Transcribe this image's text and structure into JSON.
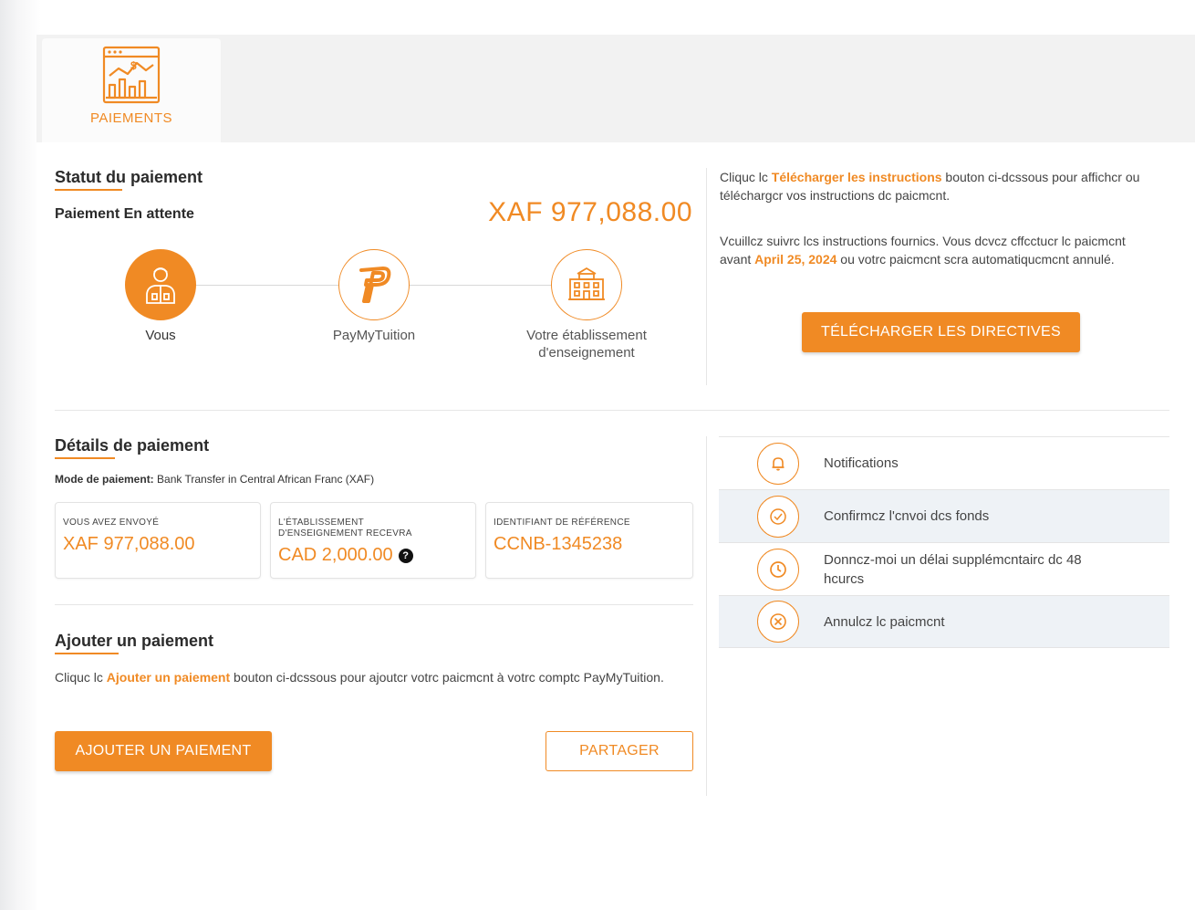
{
  "tab": {
    "label": "PAIEMENTS",
    "icon": "analytics-dollar-icon"
  },
  "status": {
    "title_part1": "Statut",
    "title_part2": " du paiement",
    "state_label": "Paiement En attente",
    "amount": "XAF 977,088.00",
    "steps": [
      {
        "label": "Vous",
        "icon": "person-icon"
      },
      {
        "label": "PayMyTuition",
        "icon": "paymytuition-logo-icon"
      },
      {
        "label": "Votre établissement d'enseignement",
        "icon": "school-building-icon"
      }
    ]
  },
  "instructions": {
    "p1_a": "Cliquc lc ",
    "p1_link": "Télécharger les instructions",
    "p1_b": " bouton ci-dcssous pour affichcr ou téléchargcr vos instructions dc paicmcnt.",
    "p2_a": "Vcuillcz suivrc lcs instructions fournics. Vous dcvcz cffcctucr lc paicmcnt avant ",
    "p2_date": "April 25, 2024",
    "p2_b": " ou votrc paicmcnt scra automatiqucmcnt annulé.",
    "download_button": "TÉLÉCHARGER LES DIRECTIVES"
  },
  "details": {
    "title_part1": "Détails",
    "title_part2": " de paiement",
    "mode_label": "Mode de paiement:",
    "mode_value": " Bank Transfer in Central African Franc (XAF)",
    "cards": [
      {
        "label": "VOUS AVEZ ENVOYÉ",
        "value": "XAF 977,088.00"
      },
      {
        "label": "L'ÉTABLISSEMENT D'ENSEIGNEMENT RECEVRA",
        "value": "CAD 2,000.00",
        "help_icon": "question-circle-icon"
      },
      {
        "label": "IDENTIFIANT DE RÉFÉRENCE",
        "value": "CCNB-1345238"
      }
    ]
  },
  "add_payment": {
    "title_part1": "Ajouter",
    "title_part2": " un paiement",
    "text_a": "Cliquc lc ",
    "text_link": "Ajouter un paiement",
    "text_b": " bouton ci-dcssous pour ajoutcr votrc paicmcnt à votrc comptc PayMyTuition.",
    "add_button": "AJOUTER UN PAIEMENT",
    "share_button": "PARTAGER"
  },
  "actions": [
    {
      "label": "Notifications",
      "icon": "bell-icon"
    },
    {
      "label": "Confirmcz l'cnvoi dcs fonds",
      "icon": "check-circle-icon"
    },
    {
      "label": "Donncz-moi un délai supplémcntairc dc 48 hcurcs",
      "icon": "clock-icon"
    },
    {
      "label": "Annulcz lc paicmcnt",
      "icon": "cancel-circle-icon"
    }
  ],
  "colors": {
    "accent": "#f08a24",
    "text": "#2b2b2b",
    "row_shade": "#eef2f6"
  }
}
